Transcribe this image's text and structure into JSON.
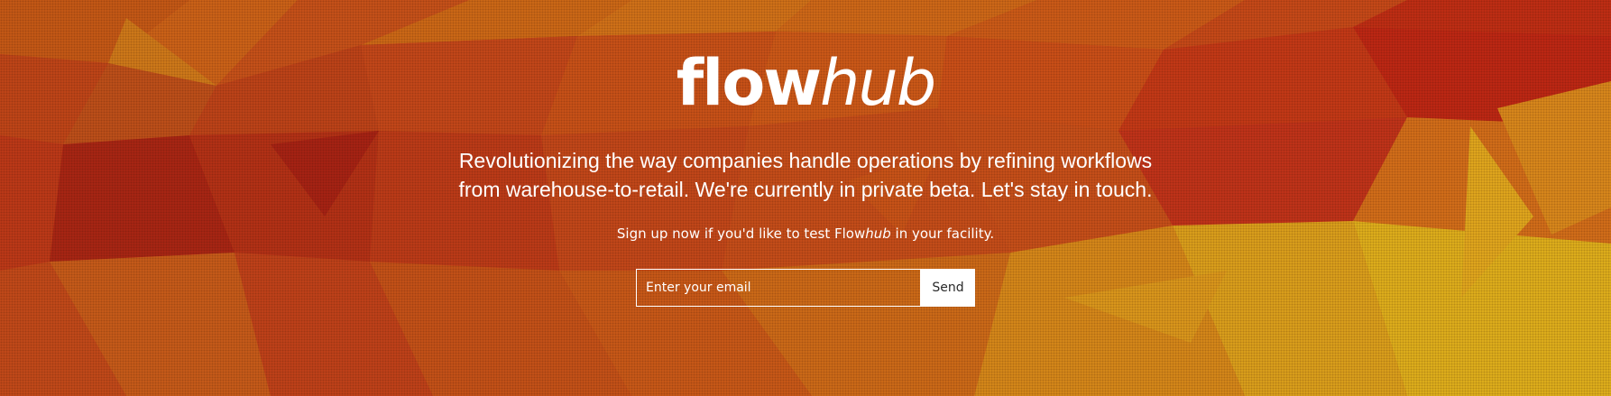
{
  "logo": {
    "strong": "flow",
    "light": "hub"
  },
  "tagline": {
    "line1": "Revolutionizing the way companies handle operations by refining workflows",
    "line2": "from warehouse-to-retail. We're currently in private beta. Let's stay in touch."
  },
  "cta": {
    "before": "Sign up now if you'd like to test Flow",
    "brand_italic": "hub",
    "after": " in your facility."
  },
  "signup": {
    "email_placeholder": "Enter your email",
    "email_value": "",
    "send_label": "Send"
  },
  "colors": {
    "accent_deep_red": "#b8240e",
    "accent_orange": "#d8641a",
    "accent_yellow": "#e6b41c",
    "text": "#ffffff"
  }
}
